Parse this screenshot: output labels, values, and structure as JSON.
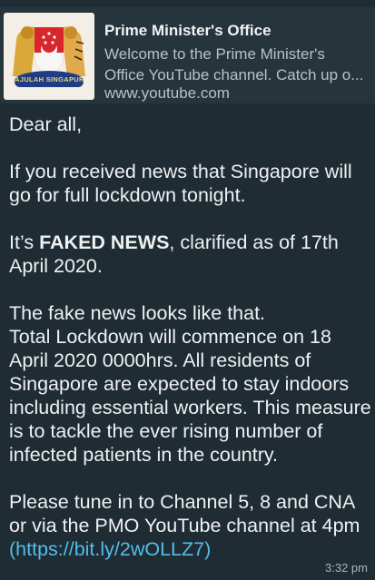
{
  "link_preview": {
    "title": "Prime Minister's Office",
    "description": "Welcome to the Prime Minister's Office YouTube channel. Catch up o...",
    "url": "www.youtube.com",
    "crest_motto": "MAJULAH SINGAPURA"
  },
  "message": {
    "greeting": "Dear all,",
    "line1": "If you received news that Singapore will go for full lockdown tonight.",
    "faked_prefix": "It’s ",
    "faked_bold": "FAKED NEWS",
    "faked_suffix": ", clarified as of 17th April 2020.",
    "fake_intro": "The fake news looks like that.",
    "fake_body": "Total Lockdown will commence on 18 April 2020 0000hrs. All residents of Singapore are expected to stay indoors including essential workers. This measure is to tackle the ever rising number of infected patients in the country.",
    "tune_in": "Please tune in to Channel 5, 8 and CNA or via the PMO YouTube channel at 4pm",
    "link_open": "(",
    "link_url": "https://bit.ly/2wOLLZ7",
    "link_close": ")"
  },
  "timestamp": "3:32 pm",
  "colors": {
    "bubble": "#1f2c33",
    "preview": "#26343b",
    "link": "#53bdeb"
  }
}
